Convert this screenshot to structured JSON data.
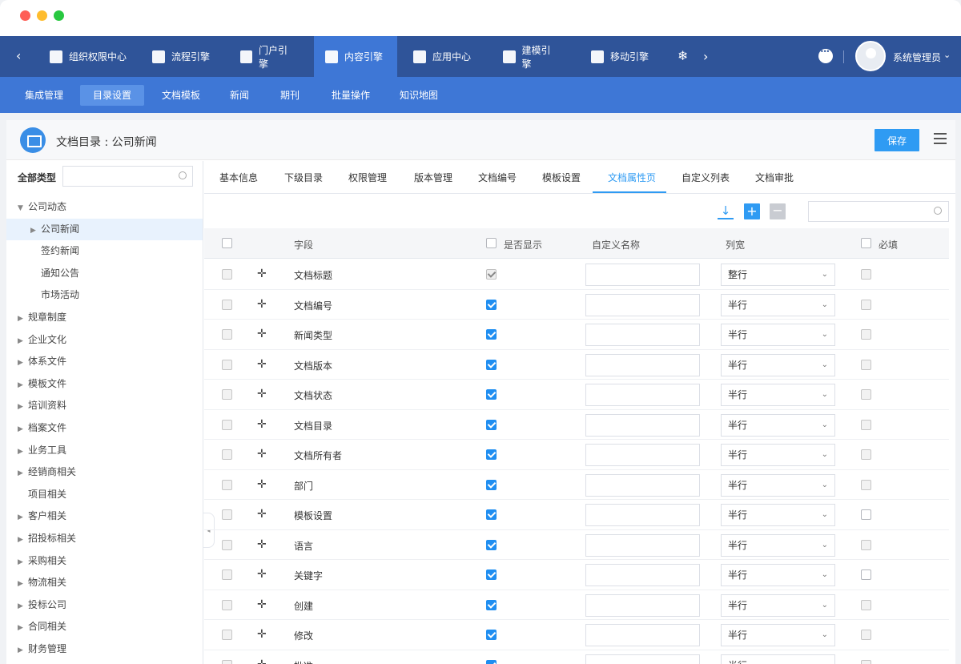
{
  "topnav": {
    "items": [
      {
        "label": "组织权限中心",
        "icon": "shield-icon"
      },
      {
        "label": "流程引擎",
        "icon": "flow-icon"
      },
      {
        "label": "门户引擎",
        "icon": "portal-icon"
      },
      {
        "label": "内容引擎",
        "icon": "document-icon",
        "active": true
      },
      {
        "label": "应用中心",
        "icon": "apps-icon"
      },
      {
        "label": "建模引擎",
        "icon": "cube-icon"
      },
      {
        "label": "移动引擎",
        "icon": "mobile-icon"
      }
    ],
    "username": "系统管理员"
  },
  "subnav": {
    "items": [
      "集成管理",
      "目录设置",
      "文档模板",
      "新闻",
      "期刊",
      "批量操作",
      "知识地图"
    ],
    "active_index": 1
  },
  "title": {
    "text": "文档目录 : 公司新闻",
    "save_label": "保存"
  },
  "sidebar": {
    "type_label": "全部类型",
    "search_placeholder": "",
    "tree": [
      {
        "label": "公司动态",
        "level": 0,
        "caret": "down"
      },
      {
        "label": "公司新闻",
        "level": 1,
        "caret": "right",
        "selected": true
      },
      {
        "label": "签约新闻",
        "level": 1,
        "caret": ""
      },
      {
        "label": "通知公告",
        "level": 1,
        "caret": ""
      },
      {
        "label": "市场活动",
        "level": 1,
        "caret": ""
      },
      {
        "label": "规章制度",
        "level": 0,
        "caret": "right"
      },
      {
        "label": "企业文化",
        "level": 0,
        "caret": "right"
      },
      {
        "label": "体系文件",
        "level": 0,
        "caret": "right"
      },
      {
        "label": "模板文件",
        "level": 0,
        "caret": "right"
      },
      {
        "label": "培训资料",
        "level": 0,
        "caret": "right"
      },
      {
        "label": "档案文件",
        "level": 0,
        "caret": "right"
      },
      {
        "label": "业务工具",
        "level": 0,
        "caret": "right"
      },
      {
        "label": "经销商相关",
        "level": 0,
        "caret": "right"
      },
      {
        "label": "项目相关",
        "level": 0,
        "caret": ""
      },
      {
        "label": "客户相关",
        "level": 0,
        "caret": "right"
      },
      {
        "label": "招投标相关",
        "level": 0,
        "caret": "right"
      },
      {
        "label": "采购相关",
        "level": 0,
        "caret": "right"
      },
      {
        "label": "物流相关",
        "level": 0,
        "caret": "right"
      },
      {
        "label": "投标公司",
        "level": 0,
        "caret": "right"
      },
      {
        "label": "合同相关",
        "level": 0,
        "caret": "right"
      },
      {
        "label": "财务管理",
        "level": 0,
        "caret": "right"
      }
    ]
  },
  "tabs": {
    "items": [
      "基本信息",
      "下级目录",
      "权限管理",
      "版本管理",
      "文档编号",
      "模板设置",
      "文档属性页",
      "自定义列表",
      "文档审批"
    ],
    "active_index": 6
  },
  "table": {
    "headers": {
      "field": "字段",
      "show": "是否显示",
      "custom_name": "自定义名称",
      "width": "列宽",
      "required": "必填"
    },
    "rows": [
      {
        "field": "文档标题",
        "show": "locked",
        "width": "整行",
        "required": "gray"
      },
      {
        "field": "文档编号",
        "show": "checked",
        "width": "半行",
        "required": "gray"
      },
      {
        "field": "新闻类型",
        "show": "checked",
        "width": "半行",
        "required": "gray"
      },
      {
        "field": "文档版本",
        "show": "checked",
        "width": "半行",
        "required": "gray"
      },
      {
        "field": "文档状态",
        "show": "checked",
        "width": "半行",
        "required": "gray"
      },
      {
        "field": "文档目录",
        "show": "checked",
        "width": "半行",
        "required": "gray"
      },
      {
        "field": "文档所有者",
        "show": "checked",
        "width": "半行",
        "required": "gray"
      },
      {
        "field": "部门",
        "show": "checked",
        "width": "半行",
        "required": "gray"
      },
      {
        "field": "模板设置",
        "show": "checked",
        "width": "半行",
        "required": "empty"
      },
      {
        "field": "语言",
        "show": "checked",
        "width": "半行",
        "required": "gray"
      },
      {
        "field": "关键字",
        "show": "checked",
        "width": "半行",
        "required": "empty"
      },
      {
        "field": "创建",
        "show": "checked",
        "width": "半行",
        "required": "gray"
      },
      {
        "field": "修改",
        "show": "checked",
        "width": "半行",
        "required": "gray"
      },
      {
        "field": "批准",
        "show": "checked",
        "width": "半行",
        "required": "gray"
      }
    ]
  }
}
